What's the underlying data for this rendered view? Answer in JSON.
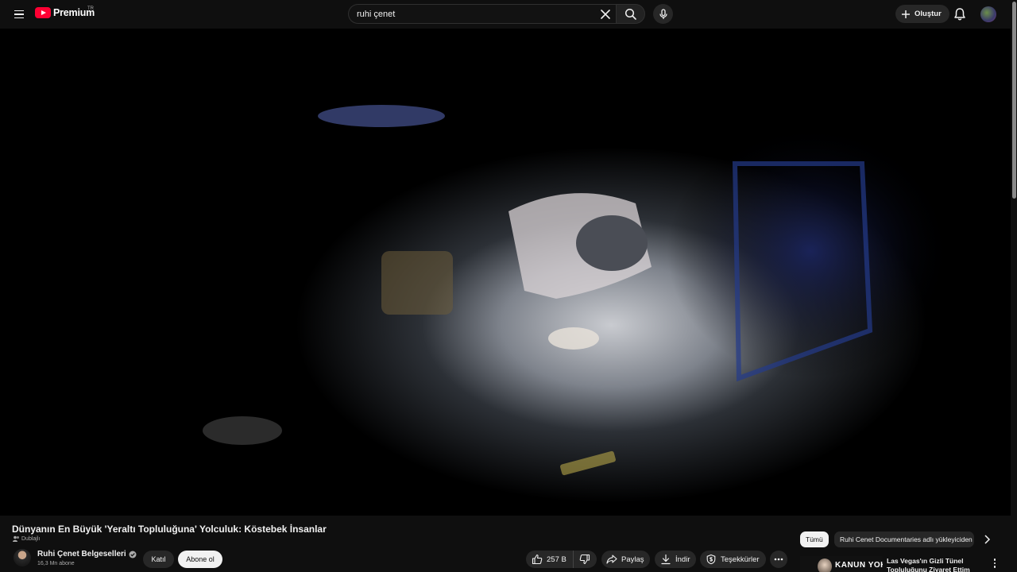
{
  "header": {
    "logo_text": "Premium",
    "logo_country": "TR",
    "search_value": "ruhi çenet",
    "create_label": "Oluştur"
  },
  "video": {
    "title": "Dünyanın En Büyük 'Yeraltı Topluluğuna' Yolculuk: Köstebek İnsanlar",
    "dub_label": "Dublajlı"
  },
  "channel": {
    "name": "Ruhi Çenet Belgeselleri",
    "subscribers": "16,3 Mn abone",
    "verified": true,
    "join_label": "Katıl",
    "subscribe_label": "Abone ol"
  },
  "actions": {
    "likes": "257 B",
    "share_label": "Paylaş",
    "download_label": "İndir",
    "thanks_label": "Teşekkürler"
  },
  "chips": {
    "all_label": "Tümü",
    "channel_label": "Ruhi Cenet Documentaries adlı yükleyiciden"
  },
  "recommendation": {
    "thumb_text": "KANUN YOK",
    "title": "Las Vegas'ın Gizli Tünel Topluluğunu Ziyaret Ettim"
  },
  "colors": {
    "background": "#0f0f0f",
    "brand_red": "#ff0033",
    "pill_bg": "#272727"
  }
}
